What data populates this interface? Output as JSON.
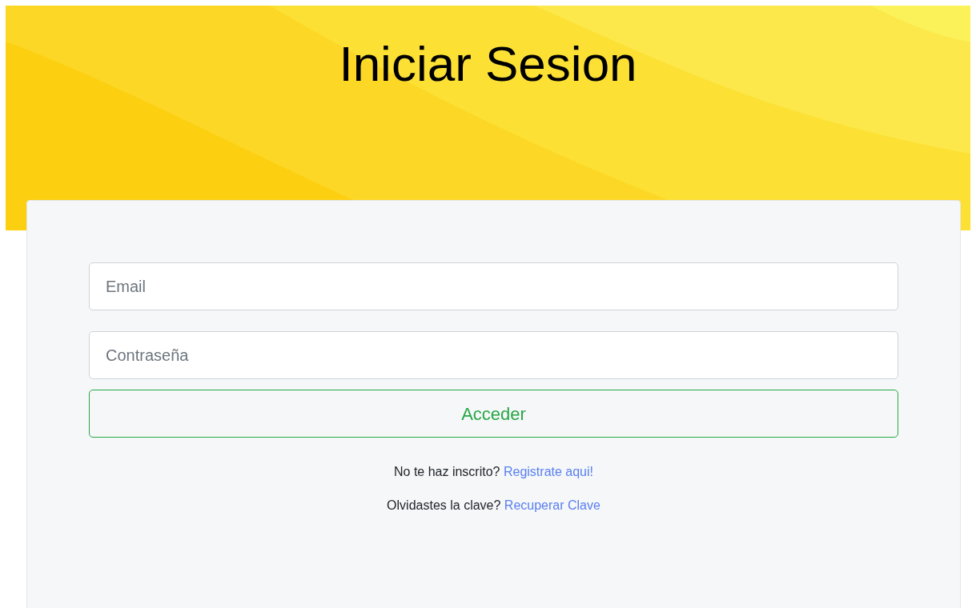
{
  "title": "Iniciar Sesion",
  "fields": [
    {
      "placeholder": "Email"
    },
    {
      "placeholder": "Contraseña"
    }
  ],
  "submit": "Acceder",
  "prompts": [
    {
      "text": "No te haz inscrito?",
      "link": "Registrate aqui!"
    },
    {
      "text": "Olvidastes la clave?",
      "link": "Recuperar Clave"
    }
  ]
}
